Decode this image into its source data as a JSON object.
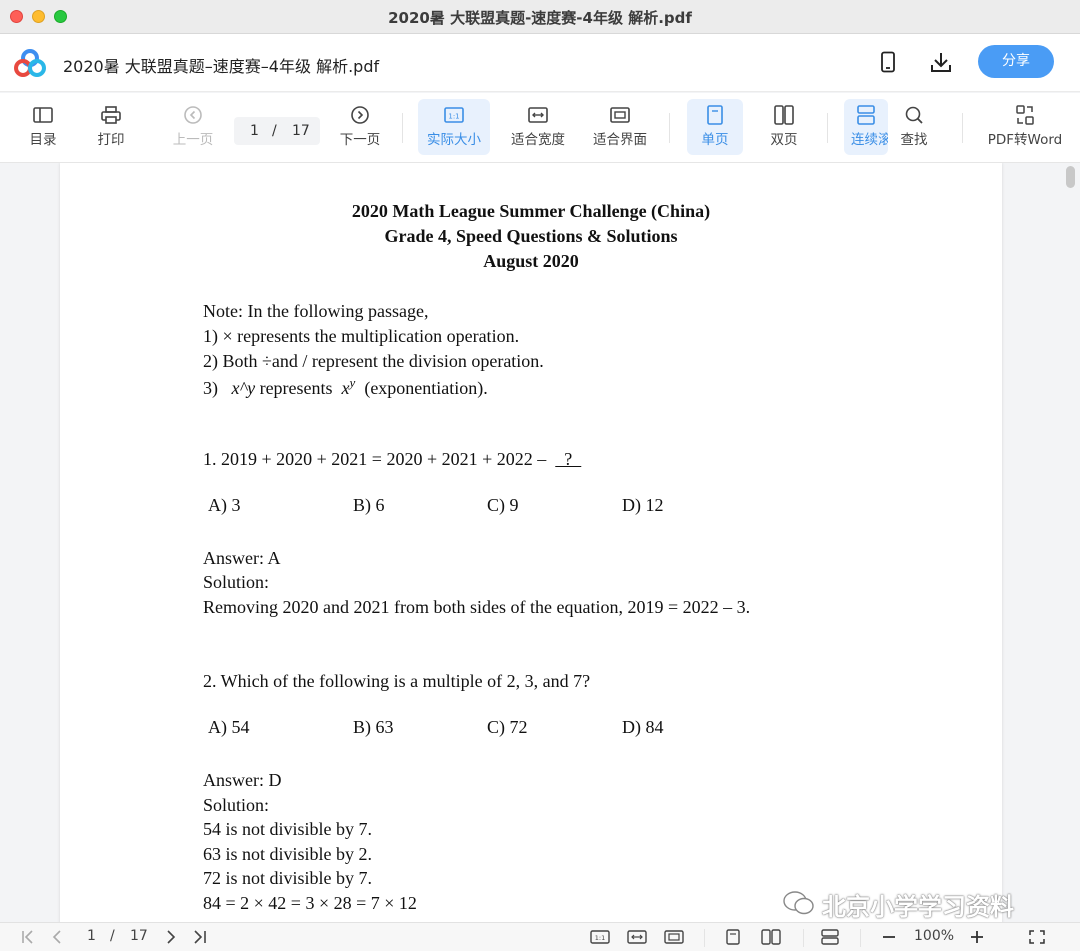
{
  "window": {
    "title": "2020暑 大联盟真题-速度赛-4年级 解析.pdf"
  },
  "header": {
    "doc_title": "2020暑 大联盟真题–速度赛–4年级 解析.pdf",
    "share_label": "分享",
    "icons": [
      "phone-icon",
      "download-icon"
    ]
  },
  "toolbar": {
    "toc": "目录",
    "print": "打印",
    "prev": "上一页",
    "page_current": "1",
    "page_sep": "/",
    "page_total": "17",
    "next": "下一页",
    "actual_size": "实际大小",
    "fit_width": "适合宽度",
    "fit_page": "适合界面",
    "single": "单页",
    "double": "双页",
    "continuous": "连续滚",
    "find": "查找",
    "to_word": "PDF转Word"
  },
  "document": {
    "title1": "2020 Math League Summer Challenge (China)",
    "title2": "Grade 4, Speed Questions & Solutions",
    "title3": "August 2020",
    "note": "Note: In the following passage,",
    "note1": "1)   × represents the multiplication operation.",
    "note2": "2)   Both ÷and  / represent the division operation.",
    "note3a": "3)   ",
    "note3b": "x^y",
    "note3c": " represents  ",
    "note3d": "x",
    "note3e": "y",
    "note3f": "  (exponentiation).",
    "q1": "1. 2019 + 2020 + 2021 = 2020 + 2021 + 2022 –  ",
    "q1_blank": "  ?  ",
    "q1_opts": [
      "A) 3",
      "B) 6",
      "C) 9",
      "D) 12"
    ],
    "q1_answer": "Answer: A",
    "q1_solution_label": "Solution:",
    "q1_solution": "Removing 2020 and 2021 from both sides of the equation, 2019 = 2022 – 3.",
    "q2": "2. Which of the following is a multiple of 2, 3, and 7?",
    "q2_opts": [
      "A) 54",
      "B) 63",
      "C) 72",
      "D) 84"
    ],
    "q2_answer": "Answer: D",
    "q2_solution_label": "Solution:",
    "q2_sol1": "54 is not divisible by 7.",
    "q2_sol2": "63 is not divisible by 2.",
    "q2_sol3": "72 is not divisible by 7.",
    "q2_sol4": "84 = 2 × 42 = 3 × 28 = 7 × 12"
  },
  "watermark": "北京小学学习资料",
  "statusbar": {
    "page_current": "1",
    "page_sep": "/",
    "page_total": "17",
    "zoom": "100%"
  }
}
